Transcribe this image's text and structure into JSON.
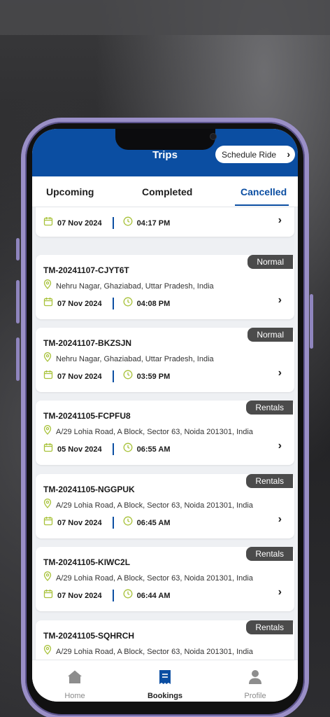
{
  "header": {
    "title": "Trips",
    "schedule_label": "Schedule Ride"
  },
  "tabs": [
    {
      "label": "Upcoming",
      "active": false
    },
    {
      "label": "Completed",
      "active": false
    },
    {
      "label": "Cancelled",
      "active": true
    }
  ],
  "first_card": {
    "date": "07 Nov 2024",
    "time": "04:17 PM"
  },
  "trips": [
    {
      "id": "TM-20241107-CJYT6T",
      "type": "Normal",
      "address": "Nehru Nagar, Ghaziabad, Uttar Pradesh, India",
      "date": "07 Nov 2024",
      "time": "04:08 PM"
    },
    {
      "id": "TM-20241107-BKZSJN",
      "type": "Normal",
      "address": "Nehru Nagar, Ghaziabad, Uttar Pradesh, India",
      "date": "07 Nov 2024",
      "time": "03:59 PM"
    },
    {
      "id": "TM-20241105-FCPFU8",
      "type": "Rentals",
      "address": "A/29 Lohia Road, A Block, Sector 63, Noida 201301, India",
      "date": "05 Nov 2024",
      "time": "06:55 AM"
    },
    {
      "id": "TM-20241105-NGGPUK",
      "type": "Rentals",
      "address": "A/29 Lohia Road, A Block, Sector 63, Noida 201301, India",
      "date": "07 Nov 2024",
      "time": "06:45 AM"
    },
    {
      "id": "TM-20241105-KIWC2L",
      "type": "Rentals",
      "address": "A/29 Lohia Road, A Block, Sector 63, Noida 201301, India",
      "date": "07 Nov 2024",
      "time": "06:44 AM"
    },
    {
      "id": "TM-20241105-SQHRCH",
      "type": "Rentals",
      "address": "A/29 Lohia Road, A Block, Sector 63, Noida 201301, India",
      "date": "",
      "time": ""
    }
  ],
  "nav": [
    {
      "label": "Home",
      "icon": "home-icon",
      "active": false
    },
    {
      "label": "Bookings",
      "icon": "bookings-icon",
      "active": true
    },
    {
      "label": "Profile",
      "icon": "profile-icon",
      "active": false
    }
  ],
  "colors": {
    "brand": "#0b4ea2",
    "badge": "#4b4b4b",
    "icon_accent": "#a8c23a"
  }
}
